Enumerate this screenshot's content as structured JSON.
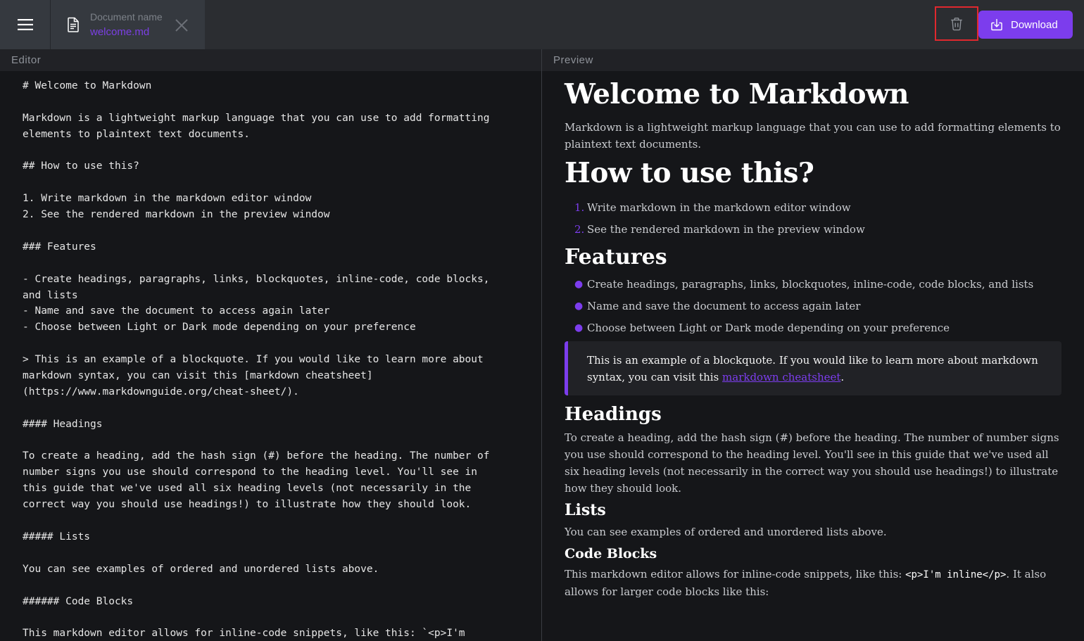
{
  "topbar": {
    "doc_label": "Document name",
    "doc_name": "welcome.md",
    "download_label": "Download",
    "accent_color": "#7c3ded",
    "icons": [
      "hamburger-menu-icon",
      "document-icon",
      "close-icon",
      "trash-icon",
      "download-icon"
    ]
  },
  "editor": {
    "header": "Editor",
    "lines": [
      "# Welcome to Markdown",
      "",
      "Markdown is a lightweight markup language that you can use to add formatting",
      "elements to plaintext text documents.",
      "",
      "## How to use this?",
      "",
      "1. Write markdown in the markdown editor window",
      "2. See the rendered markdown in the preview window",
      "",
      "### Features",
      "",
      "- Create headings, paragraphs, links, blockquotes, inline-code, code blocks,",
      "and lists",
      "- Name and save the document to access again later",
      "- Choose between Light or Dark mode depending on your preference",
      "",
      "> This is an example of a blockquote. If you would like to learn more about",
      "markdown syntax, you can visit this [markdown cheatsheet]",
      "(https://www.markdownguide.org/cheat-sheet/).",
      "",
      "#### Headings",
      "",
      "To create a heading, add the hash sign (#) before the heading. The number of",
      "number signs you use should correspond to the heading level. You'll see in",
      "this guide that we've used all six heading levels (not necessarily in the",
      "correct way you should use headings!) to illustrate how they should look.",
      "",
      "##### Lists",
      "",
      "You can see examples of ordered and unordered lists above.",
      "",
      "###### Code Blocks",
      "",
      "This markdown editor allows for inline-code snippets, like this: `<p>I'm"
    ]
  },
  "preview": {
    "header": "Preview",
    "h1": "Welcome to Markdown",
    "intro": "Markdown is a lightweight markup language that you can use to add formatting elements to plaintext text documents.",
    "h2": "How to use this?",
    "ordered": [
      {
        "marker": "1.",
        "text": "Write markdown in the markdown editor window"
      },
      {
        "marker": "2.",
        "text": "See the rendered markdown in the preview window"
      }
    ],
    "h3": "Features",
    "bullets": [
      "Create headings, paragraphs, links, blockquotes, inline-code, code blocks, and lists",
      "Name and save the document to access again later",
      "Choose between Light or Dark mode depending on your preference"
    ],
    "blockquote_before": "This is an example of a blockquote. If you would like to learn more about markdown syntax, you can visit this ",
    "blockquote_link": "markdown cheatsheet",
    "blockquote_after": ".",
    "h4": "Headings",
    "headings_text": "To create a heading, add the hash sign (#) before the heading. The number of number signs you use should correspond to the heading level. You'll see in this guide that we've used all six heading levels (not necessarily in the correct way you should use headings!) to illustrate how they should look.",
    "h5": "Lists",
    "lists_text": "You can see examples of ordered and unordered lists above.",
    "h6": "Code Blocks",
    "code_text_before": "This markdown editor allows for inline-code snippets, like this: ",
    "code_inline": "<p>I'm inline</p>",
    "code_text_after": ". It also allows for larger code blocks like this:"
  }
}
